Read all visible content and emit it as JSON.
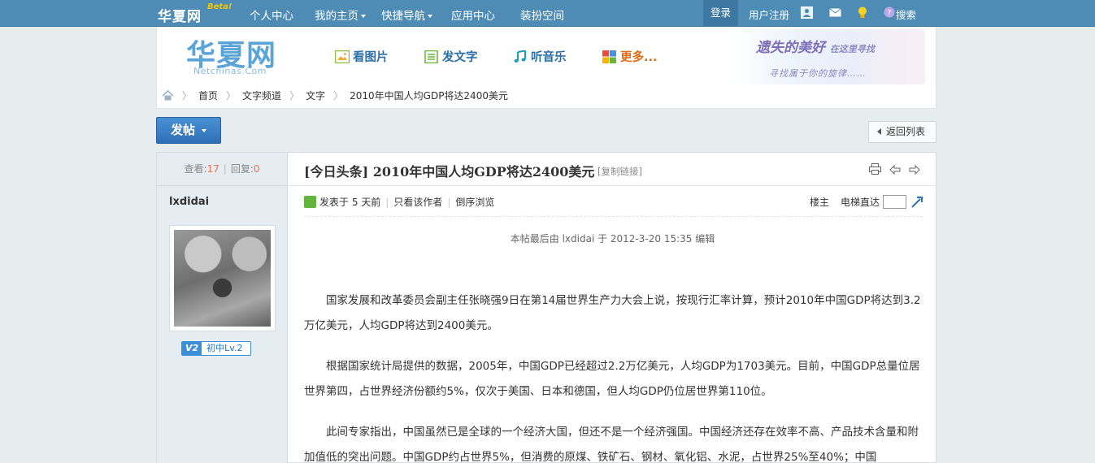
{
  "topnav": {
    "logo": "华夏网",
    "beta": "Beta!",
    "items": [
      {
        "label": "个人中心",
        "dropdown": false
      },
      {
        "label": "我的主页",
        "dropdown": true
      },
      {
        "label": "快捷导航",
        "dropdown": true
      },
      {
        "label": "应用中心",
        "dropdown": false
      },
      {
        "label": "装扮空间",
        "dropdown": false
      }
    ],
    "login": "登录",
    "register": "用户注册",
    "search": "搜索"
  },
  "header": {
    "brand": "华夏网",
    "brand_sub": "Netchinas.Com",
    "quick_links": [
      {
        "label": "看图片",
        "icon": "image-icon"
      },
      {
        "label": "发文字",
        "icon": "document-icon"
      },
      {
        "label": "听音乐",
        "icon": "music-note-icon"
      },
      {
        "label": "更多...",
        "icon": "grid-colors-icon"
      }
    ],
    "banner_line1": "遗失的美好",
    "banner_line1_small": "在这里寻找",
    "banner_line2": "寻找属于你的旋律……"
  },
  "breadcrumb": [
    "首页",
    "文字频道",
    "文字",
    "2010年中国人均GDP将达2400美元"
  ],
  "buttons": {
    "post": "发帖",
    "back": "返回列表"
  },
  "sidebar": {
    "views_label": "查看:",
    "views": "17",
    "replies_label": "回复:",
    "replies": "0",
    "author": "lxdidai",
    "level_badge": "V2",
    "level_text": "初中Lv.2"
  },
  "post": {
    "title": "[今日头条] 2010年中国人均GDP将达2400美元",
    "copy_link": "[复制链接]",
    "posted": "发表于 5 天前",
    "only_author": "只看该作者",
    "reverse": "倒序浏览",
    "floor": "楼主",
    "elevator": "电梯直达",
    "edit_note": "本帖最后由 lxdidai 于 2012-3-20 15:35 编辑",
    "paragraphs": [
      "国家发展和改革委员会副主任张晓强9日在第14届世界生产力大会上说，按现行汇率计算，预计2010年中国GDP将达到3.2万亿美元，人均GDP将达到2400美元。",
      "根据国家统计局提供的数据，2005年，中国GDP已经超过2.2万亿美元，人均GDP为1703美元。目前，中国GDP总量位居世界第四，占世界经济份额约5%，仅次于美国、日本和德国，但人均GDP仍位居世界第110位。",
      "此间专家指出，中国虽然已是全球的一个经济大国，但还不是一个经济强国。中国经济还存在效率不高、产品技术含量和附加值低的突出问题。中国GDP约占世界5%，但消费的原煤、铁矿石、钢材、氧化铝、水泥，占世界25%至40%；中国"
    ]
  }
}
